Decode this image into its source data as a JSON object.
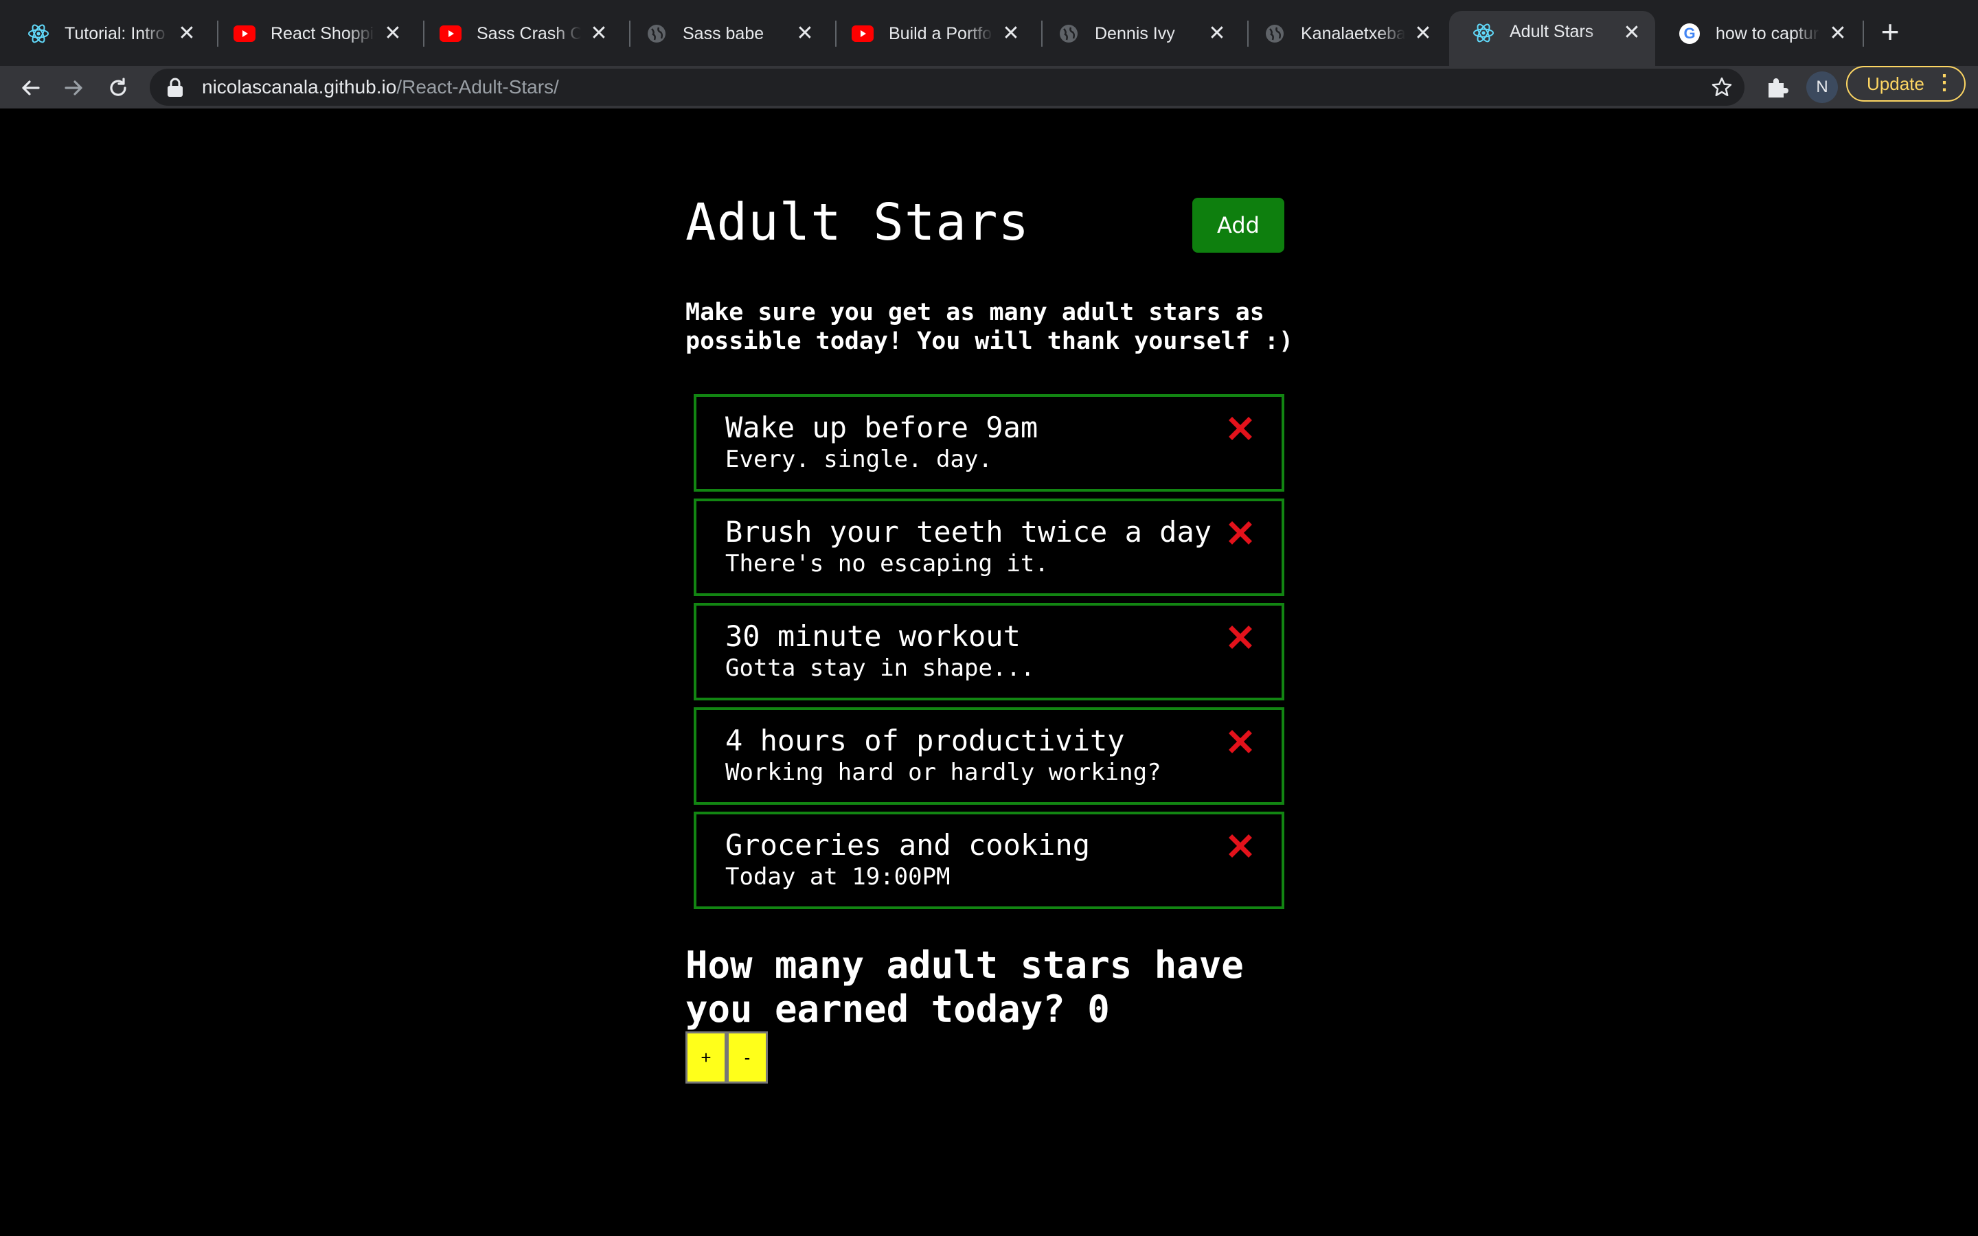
{
  "browser": {
    "tabs": [
      {
        "title": "Tutorial: Intro to",
        "icon": "react-icon",
        "active": false
      },
      {
        "title": "React Shopping",
        "icon": "youtube-icon",
        "active": false
      },
      {
        "title": "Sass Crash Cou",
        "icon": "youtube-icon",
        "active": false
      },
      {
        "title": "Sass babe",
        "icon": "globe-icon",
        "active": false
      },
      {
        "title": "Build a Portfolio",
        "icon": "youtube-icon",
        "active": false
      },
      {
        "title": "Dennis Ivy",
        "icon": "globe-icon",
        "active": false
      },
      {
        "title": "Kanalaetxebarr",
        "icon": "globe-icon",
        "active": false
      },
      {
        "title": "Adult Stars",
        "icon": "react-icon",
        "active": true
      },
      {
        "title": "how to capture",
        "icon": "google-icon",
        "active": false
      }
    ],
    "url_host": "nicolascanala.github.io",
    "url_path": "/React-Adult-Stars/",
    "profile_initial": "N",
    "update_label": "Update",
    "colors": {
      "chrome_bg": "#202124",
      "toolbar_bg": "#35363a",
      "update_accent": "#fdd663"
    }
  },
  "app": {
    "title": "Adult Stars",
    "add_label": "Add",
    "intro": "Make sure you get as many adult stars as possible today! You will thank yourself :)",
    "tasks": [
      {
        "title": "Wake up before 9am",
        "description": "Every. single. day."
      },
      {
        "title": "Brush your teeth twice a day",
        "description": "There's no escaping it."
      },
      {
        "title": "30 minute workout",
        "description": "Gotta stay in shape..."
      },
      {
        "title": "4 hours of productivity",
        "description": "Working hard or hardly working?"
      },
      {
        "title": "Groceries and cooking",
        "description": "Today at 19:00PM"
      }
    ],
    "question": "How many adult stars have you earned today? 0",
    "plus_label": "+",
    "minus_label": "-",
    "colors": {
      "background": "#000000",
      "add_button": "#0e7f0e",
      "task_border": "#128512",
      "delete": "#e3121b",
      "counter_button": "#ffff1a"
    }
  }
}
